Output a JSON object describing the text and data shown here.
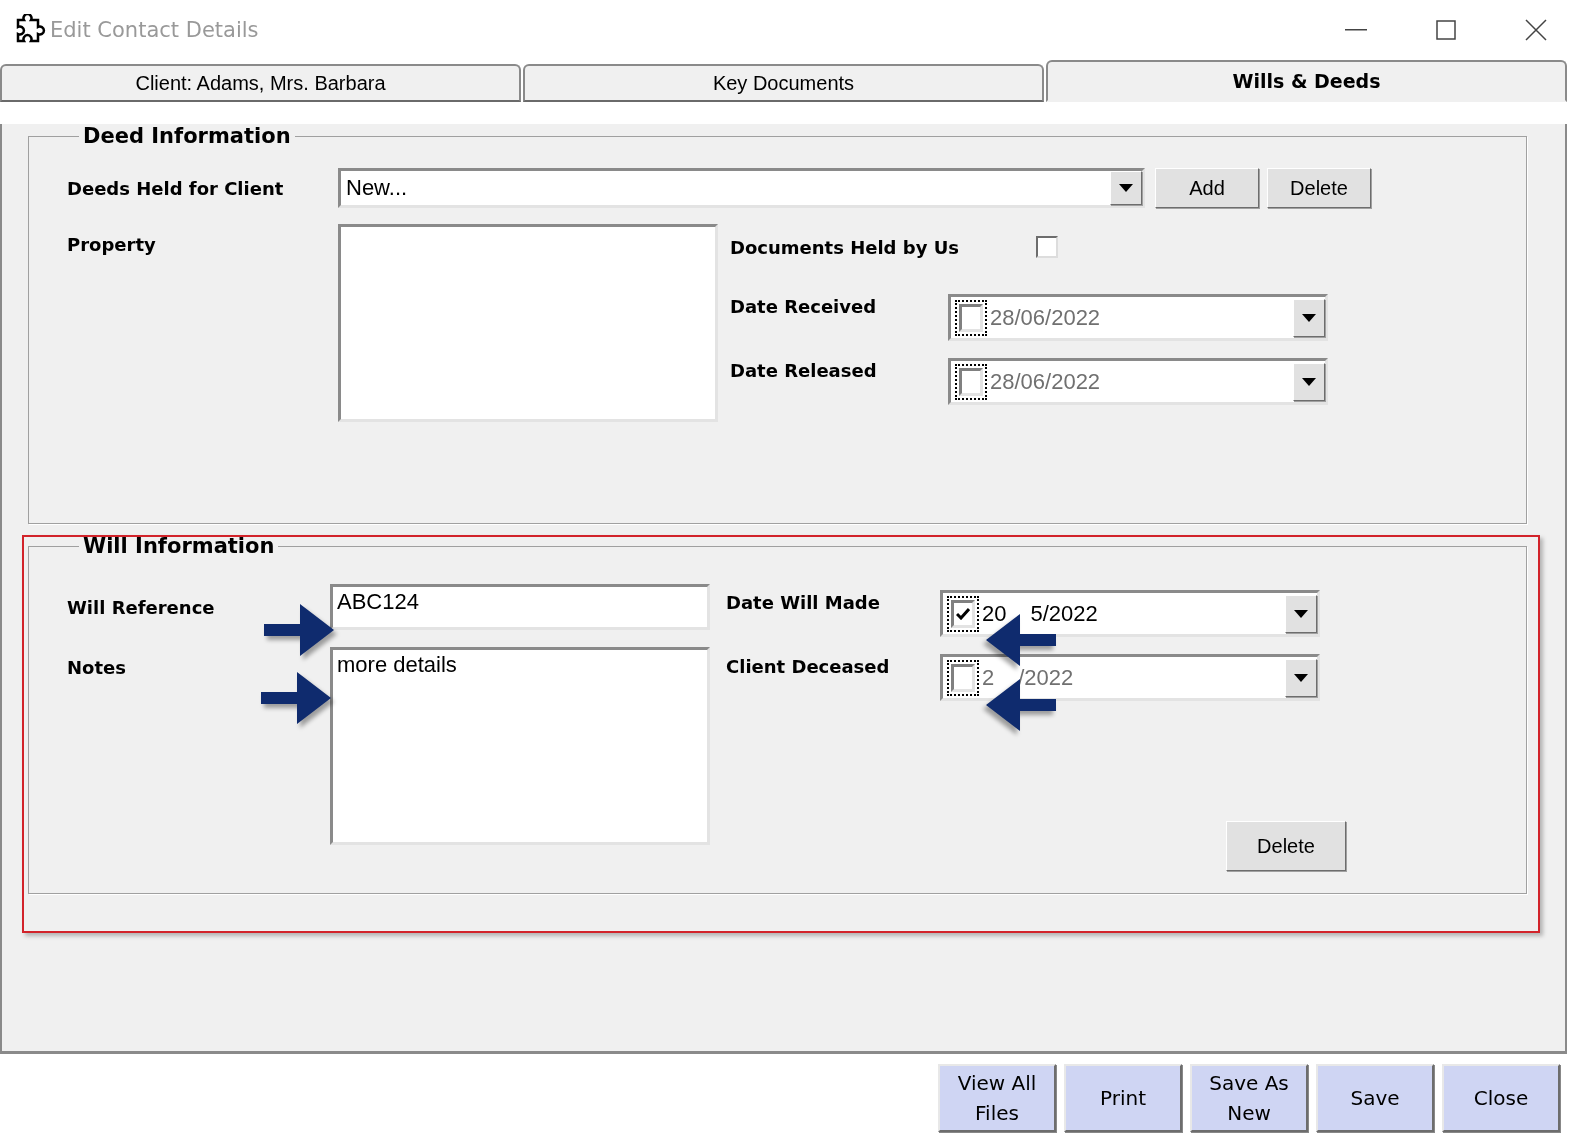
{
  "window": {
    "title": "Edit Contact Details"
  },
  "tabs": [
    {
      "label": "Client: Adams, Mrs. Barbara",
      "selected": false
    },
    {
      "label": "Key Documents",
      "selected": false
    },
    {
      "label": "Wills & Deeds",
      "selected": true
    }
  ],
  "deed_information": {
    "title": "Deed Information",
    "deeds_held": {
      "label": "Deeds Held for Client",
      "value": "New..."
    },
    "add_button": "Add",
    "delete_button": "Delete",
    "property_label": "Property",
    "documents_held": {
      "label": "Documents Held by Us",
      "checked": false
    },
    "dates": [
      {
        "label": "Date Received",
        "checked": false,
        "value_parts": [
          "28/06/2022"
        ]
      },
      {
        "label": "Date Released",
        "checked": false,
        "value_parts": [
          "28/06/2022"
        ]
      }
    ]
  },
  "will_information": {
    "title": "Will Information",
    "will_reference": {
      "label": "Will Reference",
      "value": "ABC124"
    },
    "notes": {
      "label": "Notes",
      "value": "more details"
    },
    "dates": [
      {
        "label": "Date Will Made",
        "checked": true,
        "value_parts": [
          "20",
          "5/2022"
        ]
      },
      {
        "label": "Client Deceased",
        "checked": false,
        "value_parts": [
          "2",
          "/2022"
        ]
      }
    ],
    "delete_button": "Delete"
  },
  "buttons": [
    "View All Files",
    "Print",
    "Save As New",
    "Save",
    "Close"
  ]
}
